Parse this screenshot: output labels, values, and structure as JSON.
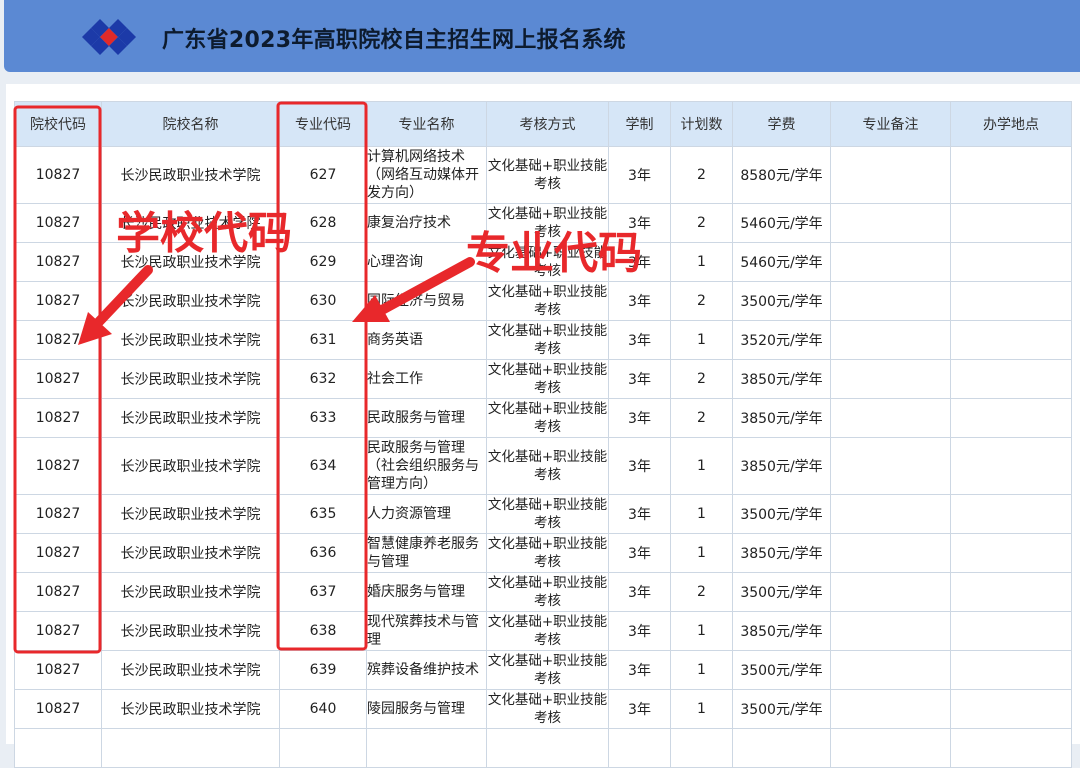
{
  "header": {
    "title": "广东省2023年高职院校自主招生网上报名系统"
  },
  "table": {
    "columns": [
      "院校代码",
      "院校名称",
      "专业代码",
      "专业名称",
      "考核方式",
      "学制",
      "计划数",
      "学费",
      "专业备注",
      "办学地点"
    ],
    "rows": [
      {
        "school_code": "10827",
        "school_name": "长沙民政职业技术学院",
        "major_code": "627",
        "major_name": "计算机网络技术（网络互动媒体开发方向）",
        "exam": "文化基础+职业技能考核",
        "years": "3年",
        "plan": "2",
        "fee": "8580元/学年",
        "note": "",
        "location": ""
      },
      {
        "school_code": "10827",
        "school_name": "长沙民政职业技术学院",
        "major_code": "628",
        "major_name": "康复治疗技术",
        "exam": "文化基础+职业技能考核",
        "years": "3年",
        "plan": "2",
        "fee": "5460元/学年",
        "note": "",
        "location": ""
      },
      {
        "school_code": "10827",
        "school_name": "长沙民政职业技术学院",
        "major_code": "629",
        "major_name": "心理咨询",
        "exam": "文化基础+职业技能考核",
        "years": "3年",
        "plan": "1",
        "fee": "5460元/学年",
        "note": "",
        "location": ""
      },
      {
        "school_code": "10827",
        "school_name": "长沙民政职业技术学院",
        "major_code": "630",
        "major_name": "国际经济与贸易",
        "exam": "文化基础+职业技能考核",
        "years": "3年",
        "plan": "2",
        "fee": "3500元/学年",
        "note": "",
        "location": ""
      },
      {
        "school_code": "10827",
        "school_name": "长沙民政职业技术学院",
        "major_code": "631",
        "major_name": "商务英语",
        "exam": "文化基础+职业技能考核",
        "years": "3年",
        "plan": "1",
        "fee": "3520元/学年",
        "note": "",
        "location": ""
      },
      {
        "school_code": "10827",
        "school_name": "长沙民政职业技术学院",
        "major_code": "632",
        "major_name": "社会工作",
        "exam": "文化基础+职业技能考核",
        "years": "3年",
        "plan": "2",
        "fee": "3850元/学年",
        "note": "",
        "location": ""
      },
      {
        "school_code": "10827",
        "school_name": "长沙民政职业技术学院",
        "major_code": "633",
        "major_name": "民政服务与管理",
        "exam": "文化基础+职业技能考核",
        "years": "3年",
        "plan": "2",
        "fee": "3850元/学年",
        "note": "",
        "location": ""
      },
      {
        "school_code": "10827",
        "school_name": "长沙民政职业技术学院",
        "major_code": "634",
        "major_name": "民政服务与管理（社会组织服务与管理方向）",
        "exam": "文化基础+职业技能考核",
        "years": "3年",
        "plan": "1",
        "fee": "3850元/学年",
        "note": "",
        "location": ""
      },
      {
        "school_code": "10827",
        "school_name": "长沙民政职业技术学院",
        "major_code": "635",
        "major_name": "人力资源管理",
        "exam": "文化基础+职业技能考核",
        "years": "3年",
        "plan": "1",
        "fee": "3500元/学年",
        "note": "",
        "location": ""
      },
      {
        "school_code": "10827",
        "school_name": "长沙民政职业技术学院",
        "major_code": "636",
        "major_name": "智慧健康养老服务与管理",
        "exam": "文化基础+职业技能考核",
        "years": "3年",
        "plan": "1",
        "fee": "3850元/学年",
        "note": "",
        "location": ""
      },
      {
        "school_code": "10827",
        "school_name": "长沙民政职业技术学院",
        "major_code": "637",
        "major_name": "婚庆服务与管理",
        "exam": "文化基础+职业技能考核",
        "years": "3年",
        "plan": "2",
        "fee": "3500元/学年",
        "note": "",
        "location": ""
      },
      {
        "school_code": "10827",
        "school_name": "长沙民政职业技术学院",
        "major_code": "638",
        "major_name": "现代殡葬技术与管理",
        "exam": "文化基础+职业技能考核",
        "years": "3年",
        "plan": "1",
        "fee": "3850元/学年",
        "note": "",
        "location": ""
      },
      {
        "school_code": "10827",
        "school_name": "长沙民政职业技术学院",
        "major_code": "639",
        "major_name": "殡葬设备维护技术",
        "exam": "文化基础+职业技能考核",
        "years": "3年",
        "plan": "1",
        "fee": "3500元/学年",
        "note": "",
        "location": ""
      },
      {
        "school_code": "10827",
        "school_name": "长沙民政职业技术学院",
        "major_code": "640",
        "major_name": "陵园服务与管理",
        "exam": "文化基础+职业技能考核",
        "years": "3年",
        "plan": "1",
        "fee": "3500元/学年",
        "note": "",
        "location": ""
      },
      {
        "school_code": "",
        "school_name": "",
        "major_code": "",
        "major_name": "",
        "exam": "",
        "years": "",
        "plan": "",
        "fee": "",
        "note": "",
        "location": ""
      }
    ]
  },
  "annotations": {
    "school_code_label": "学校代码",
    "major_code_label": "专业代码",
    "color": "#e8282b"
  },
  "icons": {
    "logo": "diamond-logo-icon"
  }
}
